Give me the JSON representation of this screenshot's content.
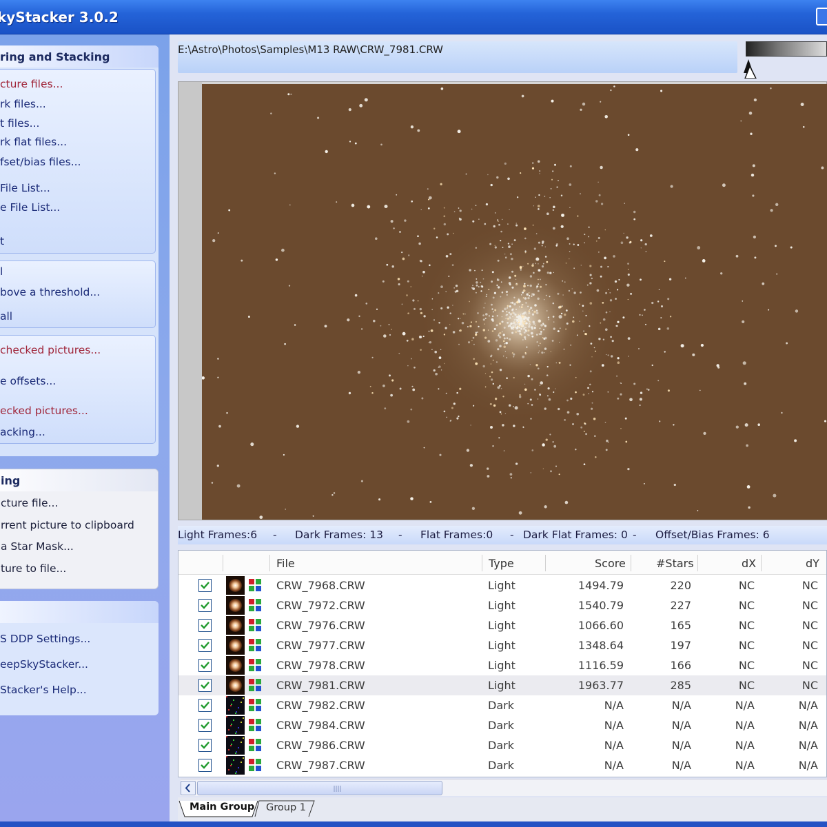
{
  "window": {
    "title": "kyStacker 3.0.2"
  },
  "left_panel": {
    "registering": {
      "header": "ring and Stacking",
      "open_items": [
        "cture files...",
        "rk files...",
        "t files...",
        "rk flat files...",
        "fset/bias files..."
      ],
      "list_items": [
        "File List...",
        "e File List..."
      ],
      "clear_item": "t",
      "check_items": [
        "l",
        "bove a threshold...",
        "all"
      ],
      "register_items": [
        "checked pictures...",
        "e offsets...",
        "ecked pictures...",
        "acking..."
      ]
    },
    "processing": {
      "header": "ing",
      "items": [
        "cture file...",
        "rrent picture to clipboard",
        "a Star Mask...",
        "ture to file..."
      ]
    },
    "options": {
      "header": "",
      "items": [
        "S DDP Settings...",
        "eepSkyStacker...",
        "Stacker's Help..."
      ]
    }
  },
  "path": "E:\\Astro\\Photos\\Samples\\M13 RAW\\CRW_7981.CRW",
  "status_line": {
    "light": "Light Frames:6",
    "sep": "-",
    "dark": "Dark Frames: 13",
    "flat": "Flat Frames:0",
    "darkflat": "Dark Flat Frames: 0",
    "bias": "Offset/Bias Frames: 6"
  },
  "table": {
    "headers": {
      "file": "File",
      "type": "Type",
      "score": "Score",
      "stars": "#Stars",
      "dx": "dX",
      "dy": "dY"
    },
    "rows": [
      {
        "file": "CRW_7968.CRW",
        "type": "Light",
        "score": "1494.79",
        "stars": "220",
        "dx": "NC",
        "dy": "NC",
        "kind": "light"
      },
      {
        "file": "CRW_7972.CRW",
        "type": "Light",
        "score": "1540.79",
        "stars": "227",
        "dx": "NC",
        "dy": "NC",
        "kind": "light"
      },
      {
        "file": "CRW_7976.CRW",
        "type": "Light",
        "score": "1066.60",
        "stars": "165",
        "dx": "NC",
        "dy": "NC",
        "kind": "light"
      },
      {
        "file": "CRW_7977.CRW",
        "type": "Light",
        "score": "1348.64",
        "stars": "197",
        "dx": "NC",
        "dy": "NC",
        "kind": "light"
      },
      {
        "file": "CRW_7978.CRW",
        "type": "Light",
        "score": "1116.59",
        "stars": "166",
        "dx": "NC",
        "dy": "NC",
        "kind": "light"
      },
      {
        "file": "CRW_7981.CRW",
        "type": "Light",
        "score": "1963.77",
        "stars": "285",
        "dx": "NC",
        "dy": "NC",
        "kind": "light"
      },
      {
        "file": "CRW_7982.CRW",
        "type": "Dark",
        "score": "N/A",
        "stars": "N/A",
        "dx": "N/A",
        "dy": "N/A",
        "kind": "dark"
      },
      {
        "file": "CRW_7984.CRW",
        "type": "Dark",
        "score": "N/A",
        "stars": "N/A",
        "dx": "N/A",
        "dy": "N/A",
        "kind": "dark"
      },
      {
        "file": "CRW_7986.CRW",
        "type": "Dark",
        "score": "N/A",
        "stars": "N/A",
        "dx": "N/A",
        "dy": "N/A",
        "kind": "dark"
      },
      {
        "file": "CRW_7987.CRW",
        "type": "Dark",
        "score": "N/A",
        "stars": "N/A",
        "dx": "N/A",
        "dy": "N/A",
        "kind": "dark"
      }
    ]
  },
  "tabs": [
    "Main Group",
    "Group 1"
  ],
  "colors": {
    "sky": "#6b4a2e",
    "selected_row": "#ebebf0",
    "accent": "#2463d8"
  }
}
